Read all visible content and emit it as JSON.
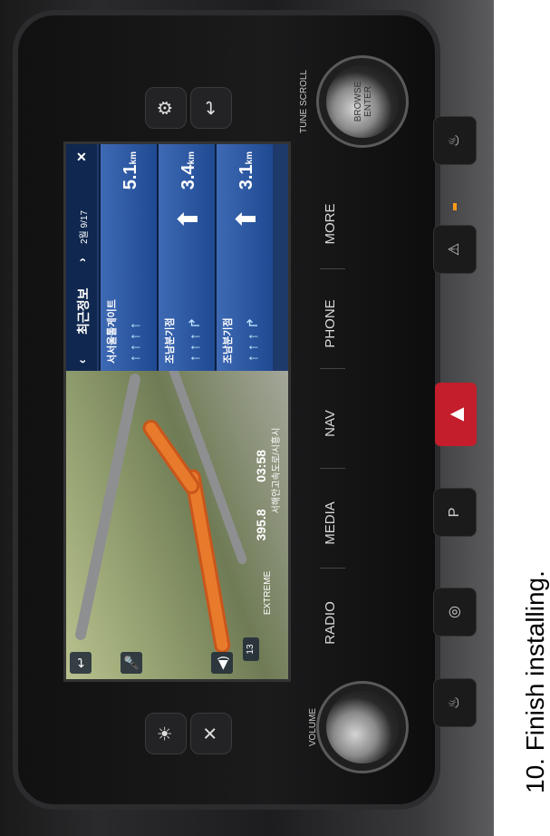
{
  "caption": "10. Finish installing.",
  "hardware": {
    "buttons": [
      "RADIO",
      "MEDIA",
      "NAV",
      "PHONE",
      "MORE"
    ],
    "volume_label": "VOLUME",
    "tune_label": "TUNE\nSCROLL",
    "browse_label": "BROWSE\nENTER"
  },
  "nav_screen": {
    "panel_title": "최근정보",
    "date_text": "2월 9/17",
    "rows": [
      {
        "name": "서서울톨게이트",
        "distance": "5.1",
        "unit": "km"
      },
      {
        "name": "조남분기점",
        "distance": "3.4",
        "unit": "km"
      },
      {
        "name": "조남분기점",
        "distance": "3.1",
        "unit": "km"
      }
    ],
    "map": {
      "speed_text": "395.8",
      "time_text": "03:58",
      "road_name": "서해안고속도로/시흥시",
      "mode_text": "EXTREME",
      "speed_limit": "13"
    }
  },
  "colors": {
    "route": "#e87a2c",
    "panel": "#1f4a92",
    "hazard": "#c41d2b"
  }
}
